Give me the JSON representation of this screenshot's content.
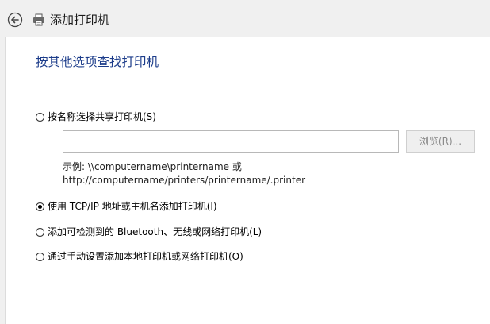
{
  "header": {
    "title": "添加打印机",
    "back_icon": "back-arrow-icon",
    "printer_icon": "printer-icon"
  },
  "main": {
    "heading": "按其他选项查找打印机",
    "options": [
      {
        "label": "按名称选择共享打印机(S)",
        "checked": false
      },
      {
        "label": "使用 TCP/IP 地址或主机名添加打印机(I)",
        "checked": true
      },
      {
        "label": "添加可检测到的 Bluetooth、无线或网络打印机(L)",
        "checked": false
      },
      {
        "label": "通过手动设置添加本地打印机或网络打印机(O)",
        "checked": false
      }
    ],
    "share_name_input": {
      "value": "",
      "placeholder": ""
    },
    "browse_button": "浏览(R)...",
    "example_line1": "示例: \\\\computername\\printername 或",
    "example_line2": "http://computername/printers/printername/.printer"
  },
  "colors": {
    "heading": "#1c3c8a",
    "background": "#f0f0f0",
    "panel": "#ffffff"
  }
}
